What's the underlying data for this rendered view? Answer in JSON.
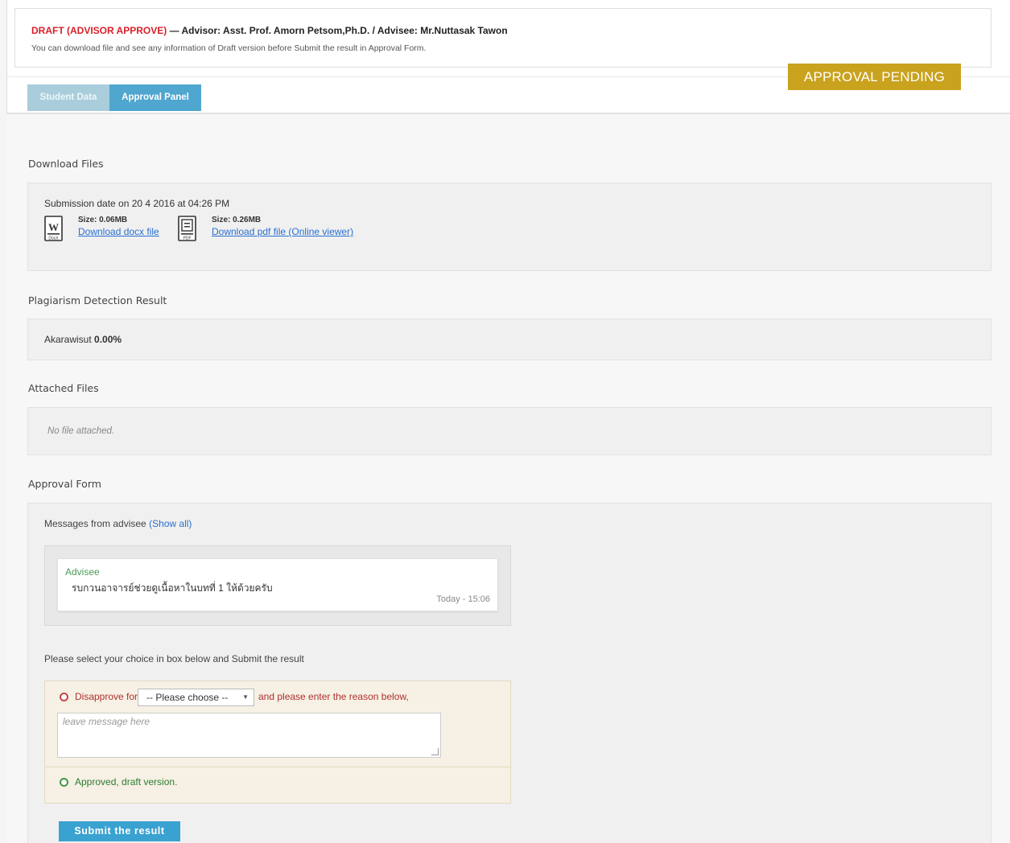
{
  "header": {
    "draft_label": "DRAFT (ADVISOR APPROVE)",
    "title_rest": "— Advisor: Asst. Prof. Amorn Petsom,Ph.D. / Advisee: Mr.Nuttasak Tawon",
    "subtitle": "You can download file and see any information of Draft version before Submit the result in Approval Form.",
    "status_badge": "APPROVAL PENDING"
  },
  "tabs": [
    {
      "label": "Student Data"
    },
    {
      "label": "Approval Panel"
    }
  ],
  "download_files": {
    "title": "Download Files",
    "submission_date": "Submission date on 20 4 2016 at 04:26 PM",
    "docx": {
      "size": "Size: 0.06MB",
      "link": "Download docx file",
      "icon": "word-docx-icon"
    },
    "pdf": {
      "size": "Size: 0.26MB",
      "link": "Download pdf file",
      "viewer": "(Online viewer)",
      "icon": "pdf-file-icon"
    }
  },
  "plagiarism": {
    "title": "Plagiarism Detection Result",
    "name": "Akarawisut",
    "value": "0.00%"
  },
  "attached": {
    "title": "Attached Files",
    "empty": "No file attached."
  },
  "approval_form": {
    "title": "Approval Form",
    "messages_label": "Messages from advisee",
    "show_all": "(Show all)",
    "message": {
      "author": "Advisee",
      "text": "รบกวนอาจารย์ช่วยดูเนื้อหาในบทที่ 1 ให้ด้วยครับ",
      "time": "Today - 15:06"
    },
    "choose_label": "Please select your choice in box below and Submit the result",
    "disapprove_label": "Disapprove for",
    "select_value": "-- Please choose --",
    "after_select": "and please enter the reason below,",
    "textarea_placeholder": "leave message here",
    "approve_label": "Approved, draft version.",
    "submit": "Submit the result"
  },
  "colors": {
    "badge": "#c9a21e",
    "tab_active": "#4fa6cf",
    "tab_inactive": "#a9cddb",
    "draft_red": "#d9202a",
    "submit": "#3aa2d0"
  }
}
